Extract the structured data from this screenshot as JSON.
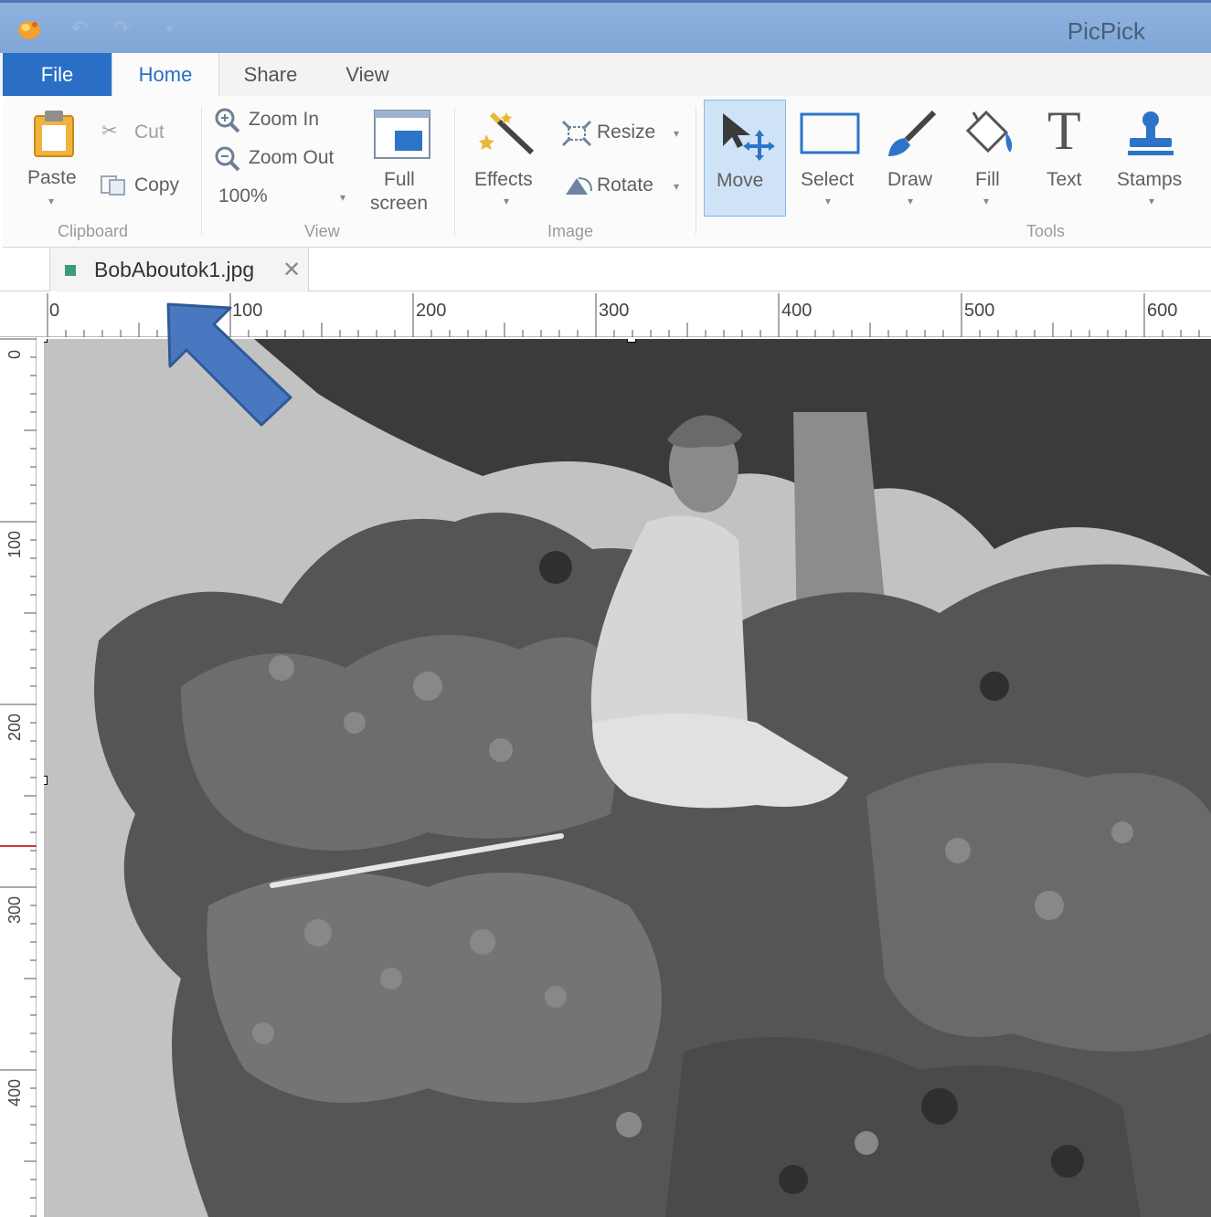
{
  "window": {
    "title": "PicPick"
  },
  "ribbon_tabs": [
    "File",
    "Home",
    "Share",
    "View"
  ],
  "clipboard": {
    "paste": "Paste",
    "cut": "Cut",
    "copy": "Copy",
    "group": "Clipboard"
  },
  "view_group": {
    "zoom_in": "Zoom In",
    "zoom_out": "Zoom Out",
    "zoom_level": "100%",
    "full_screen": [
      "Full",
      "screen"
    ],
    "group": "View"
  },
  "image_group": {
    "effects": "Effects",
    "resize": "Resize",
    "rotate": "Rotate",
    "group": "Image"
  },
  "tools_group": {
    "move": "Move",
    "select": "Select",
    "draw": "Draw",
    "fill": "Fill",
    "text": "Text",
    "stamps": "Stamps",
    "group": "Tools",
    "active_tool": "Move"
  },
  "document": {
    "tab_name": "BobAboutok1.jpg"
  },
  "ruler": {
    "horizontal_labels": [
      "0",
      "100",
      "200",
      "300",
      "400",
      "500",
      "600"
    ],
    "vertical_labels": [
      "0",
      "100",
      "200",
      "300",
      "400"
    ]
  },
  "colors": {
    "file_tab": "#2a6ec6",
    "title_bar": "#7ea6d6",
    "annotation_arrow": "#4a78c0",
    "move_highlight": "#cfe3f7"
  }
}
